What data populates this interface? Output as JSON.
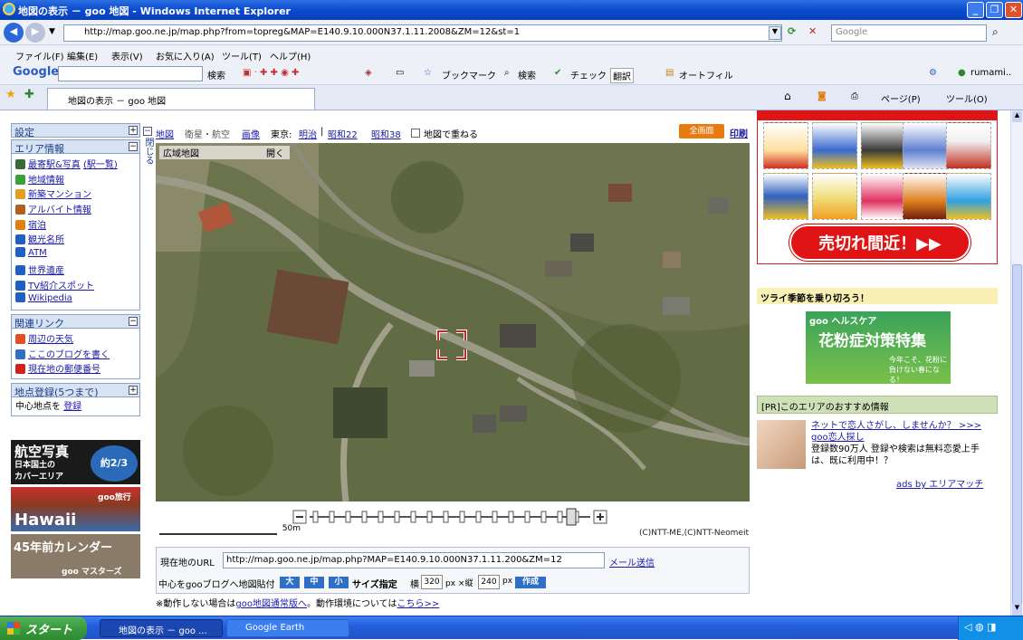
{
  "window": {
    "title": "地図の表示 － goo 地図 - Windows Internet Explorer",
    "address": "http://map.goo.ne.jp/map.php?from=topreg&MAP=E140.9.10.000N37.1.11.2008&ZM=12&st=1",
    "search_placeholder": "Google"
  },
  "menu": [
    "ファイル(F)",
    "編集(E)",
    "表示(V)",
    "お気に入り(A)",
    "ツール(T)",
    "ヘルプ(H)"
  ],
  "google_toolbar": {
    "brand": "Google",
    "search_btn": "検索",
    "items": [
      "ブックマーク",
      "検索",
      "チェック",
      "翻訳",
      "オートフィル"
    ],
    "user": "rumami.."
  },
  "tab": {
    "label": "地図の表示 － goo 地図",
    "page_menu": "ページ(P)",
    "tools_menu": "ツール(O)"
  },
  "sidebar": {
    "settings": "設定",
    "area_info": "エリア情報",
    "close_label": "閉じる",
    "area_items": [
      "最寄駅&写真",
      "地域情報",
      "新築マンション",
      "アルバイト情報",
      "宿泊",
      "観光名所",
      "ATM",
      "世界遺産",
      "TV紹介スポット",
      "Wikipedia"
    ],
    "station_list": "(駅一覧)",
    "related": "関連リンク",
    "related_items": [
      "周辺の天気",
      "ここのブログを書く",
      "現在地の郵便番号"
    ],
    "register": "地点登録(5つまで)",
    "register_center": "中心地点を",
    "register_link": "登録",
    "ad_aerial": [
      "航空写真",
      "日本国土の",
      "カバーエリア",
      "約2/3"
    ],
    "ad_hawaii": [
      "Hawaii",
      "goo旅行"
    ],
    "ad_calendar": [
      "45年前カレンダー",
      "goo マスターズ"
    ]
  },
  "map_tools": {
    "items": [
      "地図",
      "衛星・航空",
      "画像",
      "東京:",
      "明治",
      "昭和22",
      "昭和38",
      "地図で重ねる"
    ],
    "fullscreen": "全画面",
    "print": "印刷",
    "region_label": "広域地図",
    "region_btn": "開く",
    "scale": "50m",
    "copyright": "(C)NTT-ME,(C)NTT-Neomeit"
  },
  "url_panel": {
    "current_url_label": "現在地のURL",
    "current_url": "http://map.goo.ne.jp/map.php?MAP=E140.9.10.000N37.1.11.200&ZM=12",
    "mail_link": "メール送信",
    "blog_label": "中心をgooブログへ地図貼付",
    "size_buttons": [
      "大",
      "中",
      "小"
    ],
    "size_label": "サイズ指定",
    "width_label": "横",
    "width_value": "320",
    "by_label": "px ×縦",
    "height_value": "240",
    "px_label": "px",
    "create_button": "作成"
  },
  "note": {
    "prefix": "※動作しない場合は",
    "link1": "goo地図通常版へ",
    "middle": "。動作環境については",
    "link2": "こちら>>"
  },
  "right": {
    "sellout_text": "売切れ間近！▶▶",
    "season_text": "ツライ季節を乗り切ろう！",
    "pollen_brand": "goo ヘルスケア",
    "pollen_title": "花粉症対策特集",
    "pollen_sub": "今年こそ、花粉に負けない春になる！",
    "pr_header": "[PR]このエリアのおすすめ情報",
    "pr_link": "ネットで恋人さがし、しませんか？ >>> goo恋人探し",
    "pr_text": "登録数90万人 登録や検索は無料恋愛上手は、既に利用中！？",
    "pr_by": "ads by エリアマッチ"
  },
  "taskbar": {
    "start": "スタート",
    "tasks": [
      "地図の表示 － goo ...",
      "Google Earth"
    ]
  }
}
